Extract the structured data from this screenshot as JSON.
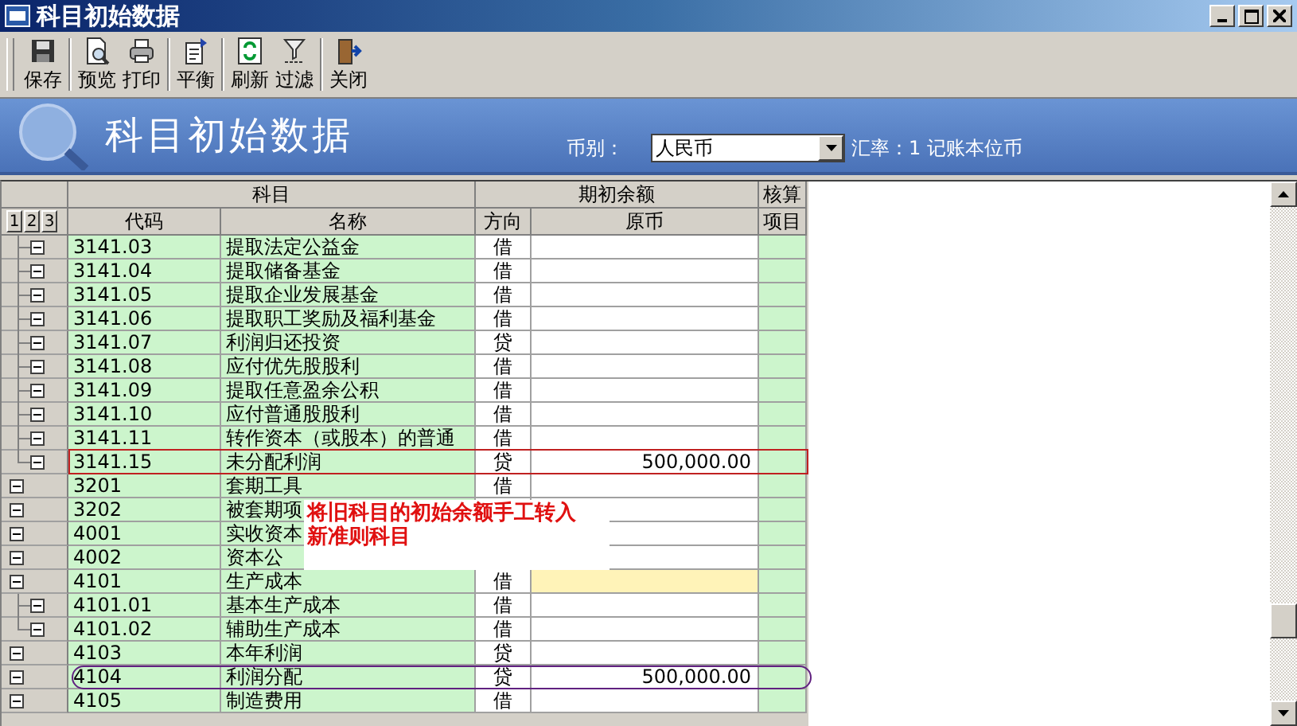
{
  "window": {
    "title": "科目初始数据"
  },
  "toolbar": [
    {
      "label": "保存",
      "kind": "save"
    },
    {
      "label": "预览",
      "kind": "preview"
    },
    {
      "label": "打印",
      "kind": "print"
    },
    {
      "label": "平衡",
      "kind": "balance"
    },
    {
      "label": "刷新",
      "kind": "refresh"
    },
    {
      "label": "过滤",
      "kind": "filter"
    },
    {
      "label": "关闭",
      "kind": "close"
    }
  ],
  "banner": {
    "title": "科目初始数据",
    "currency_label": "币别：",
    "currency": "人民币",
    "rate": "汇率：1 记账本位币"
  },
  "table": {
    "groups": [
      "科目",
      "期初余额",
      "核算"
    ],
    "level_buttons": [
      "1",
      "2",
      "3"
    ],
    "columns": [
      "代码",
      "名称",
      "方向",
      "原币",
      "项目"
    ],
    "rows": [
      {
        "children": [
          {
            "code": "3141.03",
            "name": "提取法定公益金",
            "direction": "借",
            "expanded": true,
            "selected": false
          },
          {
            "code": "3141.04",
            "name": "提取储备基金",
            "direction": "借",
            "expanded": true,
            "selected": false
          },
          {
            "code": "3141.05",
            "name": "提取企业发展基金",
            "direction": "借",
            "expanded": true,
            "selected": false
          },
          {
            "code": "3141.06",
            "name": "提取职工奖励及福利基金",
            "direction": "借",
            "expanded": true,
            "selected": false
          },
          {
            "code": "3141.07",
            "name": "利润归还投资",
            "direction": "贷",
            "expanded": true,
            "selected": false
          },
          {
            "code": "3141.08",
            "name": "应付优先股股利",
            "direction": "借",
            "expanded": true,
            "selected": false
          },
          {
            "code": "3141.09",
            "name": "提取任意盈余公积",
            "direction": "借",
            "expanded": true,
            "selected": false
          },
          {
            "code": "3141.10",
            "name": "应付普通股股利",
            "direction": "借",
            "expanded": true,
            "selected": false
          },
          {
            "code": "3141.11",
            "name": "转作资本（或股本）的普通",
            "direction": "借",
            "expanded": true,
            "selected": false
          },
          {
            "code": "3141.15",
            "name": "未分配利润",
            "direction": "贷",
            "amount": "500,000.00",
            "expanded": true,
            "selected": false,
            "kind": "boxed"
          }
        ]
      },
      {
        "code": "3201",
        "name": "套期工具",
        "direction": "借",
        "expanded": true,
        "selected": false
      },
      {
        "code": "3202",
        "name": "被套期项",
        "expanded": true,
        "selected": false
      },
      {
        "code": "4001",
        "name": "实收资本",
        "expanded": true,
        "selected": false
      },
      {
        "code": "4002",
        "name": "资本公",
        "expanded": true,
        "selected": false
      },
      {
        "code": "4101",
        "name": "生产成本",
        "direction": "借",
        "expanded": true,
        "selected": true,
        "children": [
          {
            "code": "4101.01",
            "name": "基本生产成本",
            "direction": "借",
            "expanded": true,
            "selected": false
          },
          {
            "code": "4101.02",
            "name": "辅助生产成本",
            "direction": "借",
            "expanded": true,
            "selected": false
          }
        ]
      },
      {
        "code": "4103",
        "name": "本年利润",
        "direction": "贷",
        "expanded": true,
        "selected": false
      },
      {
        "code": "4104",
        "name": "利润分配",
        "direction": "贷",
        "amount": "500,000.00",
        "expanded": true,
        "selected": false,
        "kind": "circled"
      },
      {
        "code": "4105",
        "name": "制造费用",
        "direction": "借",
        "expanded": true,
        "selected": false
      }
    ]
  },
  "annotation": {
    "lines": [
      "将旧科目的初始余额手工转入",
      "新准则科目"
    ]
  }
}
